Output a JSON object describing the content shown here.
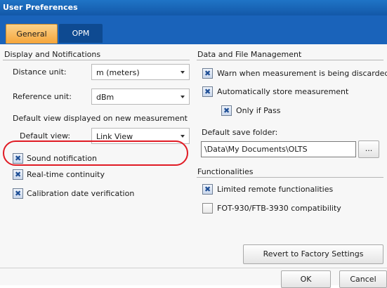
{
  "window": {
    "title": "User Preferences"
  },
  "tabs": [
    {
      "label": "General",
      "active": true
    },
    {
      "label": "OPM",
      "active": false
    }
  ],
  "display": {
    "heading": "Display and Notifications",
    "distance_unit": {
      "label": "Distance unit:",
      "value": "m (meters)"
    },
    "reference_unit": {
      "label": "Reference unit:",
      "value": "dBm"
    },
    "default_view_heading": "Default view displayed on new measurement",
    "default_view": {
      "label": "Default view:",
      "value": "Link View"
    },
    "checkboxes": [
      {
        "label": "Sound notification",
        "checked": true
      },
      {
        "label": "Real-time continuity",
        "checked": true
      },
      {
        "label": "Calibration date verification",
        "checked": true
      }
    ]
  },
  "data_file": {
    "heading": "Data and File Management",
    "warn": {
      "label": "Warn when measurement is being discarded",
      "checked": true
    },
    "auto_store": {
      "label": "Automatically store measurement",
      "checked": true
    },
    "only_if_pass": {
      "label": "Only if Pass",
      "checked": true
    },
    "save_folder_label": "Default save folder:",
    "save_folder_value": "\\Data\\My Documents\\OLTS",
    "browse_label": "..."
  },
  "functionalities": {
    "heading": "Functionalities",
    "limited_remote": {
      "label": "Limited remote functionalities",
      "checked": true
    },
    "fot_compat": {
      "label": "FOT-930/FTB-3930 compatibility",
      "checked": false
    }
  },
  "buttons": {
    "revert": "Revert to Factory Settings",
    "ok": "OK",
    "cancel": "Cancel"
  },
  "colors": {
    "title_bar": "#1a63ba",
    "active_tab": "#f5a53a",
    "highlight": "#e01b24"
  }
}
